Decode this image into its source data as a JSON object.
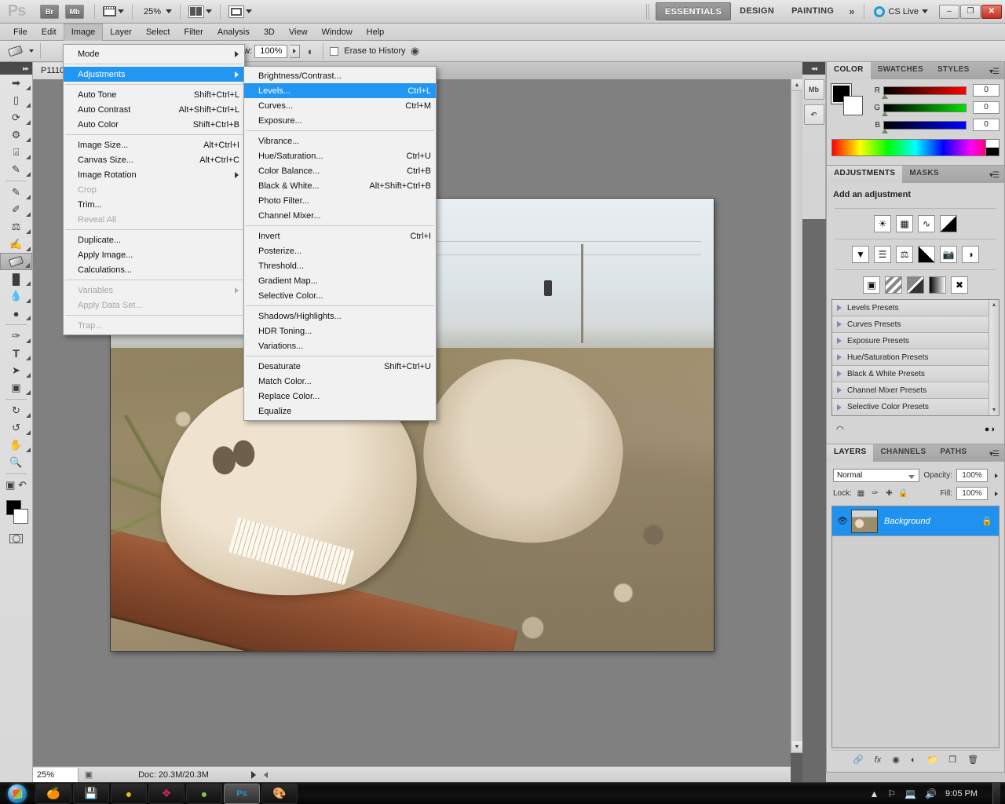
{
  "app": {
    "logo": "Ps",
    "bridge_label": "Br",
    "minibridge_label": "Mb",
    "zoom_level": "25%",
    "workspaces": [
      {
        "label": "ESSENTIALS",
        "active": true
      },
      {
        "label": "DESIGN",
        "active": false
      },
      {
        "label": "PAINTING",
        "active": false
      }
    ],
    "more_workspaces": "»",
    "cs_live": "CS Live",
    "window_buttons": {
      "minimize": "–",
      "restore": "❐",
      "close": "✕"
    }
  },
  "menubar": {
    "items": [
      {
        "label": "File",
        "open": false
      },
      {
        "label": "Edit",
        "open": false
      },
      {
        "label": "Image",
        "open": true
      },
      {
        "label": "Layer",
        "open": false
      },
      {
        "label": "Select",
        "open": false
      },
      {
        "label": "Filter",
        "open": false
      },
      {
        "label": "Analysis",
        "open": false
      },
      {
        "label": "3D",
        "open": false
      },
      {
        "label": "View",
        "open": false
      },
      {
        "label": "Window",
        "open": false
      },
      {
        "label": "Help",
        "open": false
      }
    ]
  },
  "options_bar": {
    "flow_label": "Flow:",
    "flow_value": "100%",
    "erase_to_history_label": "Erase to History",
    "erase_to_history_checked": false
  },
  "image_menu": {
    "items": [
      {
        "label": "Mode",
        "shortcut": "",
        "submenu": true,
        "disabled": false,
        "highlight": false
      },
      {
        "separator": true
      },
      {
        "label": "Adjustments",
        "shortcut": "",
        "submenu": true,
        "disabled": false,
        "highlight": true
      },
      {
        "separator": true
      },
      {
        "label": "Auto Tone",
        "shortcut": "Shift+Ctrl+L",
        "submenu": false,
        "disabled": false,
        "highlight": false
      },
      {
        "label": "Auto Contrast",
        "shortcut": "Alt+Shift+Ctrl+L",
        "submenu": false,
        "disabled": false,
        "highlight": false
      },
      {
        "label": "Auto Color",
        "shortcut": "Shift+Ctrl+B",
        "submenu": false,
        "disabled": false,
        "highlight": false
      },
      {
        "separator": true
      },
      {
        "label": "Image Size...",
        "shortcut": "Alt+Ctrl+I",
        "submenu": false,
        "disabled": false,
        "highlight": false
      },
      {
        "label": "Canvas Size...",
        "shortcut": "Alt+Ctrl+C",
        "submenu": false,
        "disabled": false,
        "highlight": false
      },
      {
        "label": "Image Rotation",
        "shortcut": "",
        "submenu": true,
        "disabled": false,
        "highlight": false
      },
      {
        "label": "Crop",
        "shortcut": "",
        "submenu": false,
        "disabled": true,
        "highlight": false
      },
      {
        "label": "Trim...",
        "shortcut": "",
        "submenu": false,
        "disabled": false,
        "highlight": false
      },
      {
        "label": "Reveal All",
        "shortcut": "",
        "submenu": false,
        "disabled": true,
        "highlight": false
      },
      {
        "separator": true
      },
      {
        "label": "Duplicate...",
        "shortcut": "",
        "submenu": false,
        "disabled": false,
        "highlight": false
      },
      {
        "label": "Apply Image...",
        "shortcut": "",
        "submenu": false,
        "disabled": false,
        "highlight": false
      },
      {
        "label": "Calculations...",
        "shortcut": "",
        "submenu": false,
        "disabled": false,
        "highlight": false
      },
      {
        "separator": true
      },
      {
        "label": "Variables",
        "shortcut": "",
        "submenu": true,
        "disabled": true,
        "highlight": false
      },
      {
        "label": "Apply Data Set...",
        "shortcut": "",
        "submenu": false,
        "disabled": true,
        "highlight": false
      },
      {
        "separator": true
      },
      {
        "label": "Trap...",
        "shortcut": "",
        "submenu": false,
        "disabled": true,
        "highlight": false
      }
    ]
  },
  "adjustments_menu": {
    "items": [
      {
        "label": "Brightness/Contrast...",
        "shortcut": "",
        "disabled": false,
        "highlight": false
      },
      {
        "label": "Levels...",
        "shortcut": "Ctrl+L",
        "disabled": false,
        "highlight": true
      },
      {
        "label": "Curves...",
        "shortcut": "Ctrl+M",
        "disabled": false,
        "highlight": false
      },
      {
        "label": "Exposure...",
        "shortcut": "",
        "disabled": false,
        "highlight": false
      },
      {
        "separator": true
      },
      {
        "label": "Vibrance...",
        "shortcut": "",
        "disabled": false,
        "highlight": false
      },
      {
        "label": "Hue/Saturation...",
        "shortcut": "Ctrl+U",
        "disabled": false,
        "highlight": false
      },
      {
        "label": "Color Balance...",
        "shortcut": "Ctrl+B",
        "disabled": false,
        "highlight": false
      },
      {
        "label": "Black & White...",
        "shortcut": "Alt+Shift+Ctrl+B",
        "disabled": false,
        "highlight": false
      },
      {
        "label": "Photo Filter...",
        "shortcut": "",
        "disabled": false,
        "highlight": false
      },
      {
        "label": "Channel Mixer...",
        "shortcut": "",
        "disabled": false,
        "highlight": false
      },
      {
        "separator": true
      },
      {
        "label": "Invert",
        "shortcut": "Ctrl+I",
        "disabled": false,
        "highlight": false
      },
      {
        "label": "Posterize...",
        "shortcut": "",
        "disabled": false,
        "highlight": false
      },
      {
        "label": "Threshold...",
        "shortcut": "",
        "disabled": false,
        "highlight": false
      },
      {
        "label": "Gradient Map...",
        "shortcut": "",
        "disabled": false,
        "highlight": false
      },
      {
        "label": "Selective Color...",
        "shortcut": "",
        "disabled": false,
        "highlight": false
      },
      {
        "separator": true
      },
      {
        "label": "Shadows/Highlights...",
        "shortcut": "",
        "disabled": false,
        "highlight": false
      },
      {
        "label": "HDR Toning...",
        "shortcut": "",
        "disabled": false,
        "highlight": false
      },
      {
        "label": "Variations...",
        "shortcut": "",
        "disabled": false,
        "highlight": false
      },
      {
        "separator": true
      },
      {
        "label": "Desaturate",
        "shortcut": "Shift+Ctrl+U",
        "disabled": false,
        "highlight": false
      },
      {
        "label": "Match Color...",
        "shortcut": "",
        "disabled": false,
        "highlight": false
      },
      {
        "label": "Replace Color...",
        "shortcut": "",
        "disabled": false,
        "highlight": false
      },
      {
        "label": "Equalize",
        "shortcut": "",
        "disabled": false,
        "highlight": false
      }
    ]
  },
  "toolbox": {
    "tools": [
      {
        "name": "move-tool",
        "glyph": "⤡",
        "selected": false
      },
      {
        "name": "marquee-tool",
        "glyph": "▢",
        "selected": false
      },
      {
        "name": "lasso-tool",
        "glyph": "⟲",
        "selected": false
      },
      {
        "name": "quick-selection-tool",
        "glyph": "❦",
        "selected": false
      },
      {
        "name": "crop-tool",
        "glyph": "⌧",
        "selected": false
      },
      {
        "name": "eyedropper-tool",
        "glyph": "✒",
        "selected": false
      },
      {
        "name": "spot-healing-brush-tool",
        "glyph": "✎",
        "selected": false
      },
      {
        "name": "brush-tool",
        "glyph": "✐",
        "selected": false
      },
      {
        "name": "clone-stamp-tool",
        "glyph": "⚑",
        "selected": false
      },
      {
        "name": "history-brush-tool",
        "glyph": "✍",
        "selected": false
      },
      {
        "name": "eraser-tool",
        "glyph": "▱",
        "selected": true
      },
      {
        "name": "gradient-tool",
        "glyph": "◨",
        "selected": false
      },
      {
        "name": "blur-tool",
        "glyph": "●",
        "selected": false
      },
      {
        "name": "dodge-tool",
        "glyph": "⚲",
        "selected": false
      },
      {
        "name": "pen-tool",
        "glyph": "✑",
        "selected": false
      },
      {
        "name": "type-tool",
        "glyph": "T",
        "selected": false
      },
      {
        "name": "path-selection-tool",
        "glyph": "➤",
        "selected": false
      },
      {
        "name": "shape-tool",
        "glyph": "■",
        "selected": false
      },
      {
        "name": "3d-rotate-tool",
        "glyph": "↻",
        "selected": false
      },
      {
        "name": "3d-orbit-tool",
        "glyph": "↺",
        "selected": false
      },
      {
        "name": "hand-tool",
        "glyph": "✋",
        "selected": false
      },
      {
        "name": "zoom-tool",
        "glyph": "⚲",
        "selected": false
      }
    ],
    "foreground_color": "#000000",
    "background_color": "#ffffff"
  },
  "document": {
    "tab_title": "P1110",
    "zoom_value": "25%",
    "doc_info": "Doc: 20.3M/20.3M"
  },
  "color_panel": {
    "tabs": [
      {
        "label": "COLOR",
        "active": true
      },
      {
        "label": "SWATCHES",
        "active": false
      },
      {
        "label": "STYLES",
        "active": false
      }
    ],
    "channels": [
      {
        "label": "R",
        "value": "0"
      },
      {
        "label": "G",
        "value": "0"
      },
      {
        "label": "B",
        "value": "0"
      }
    ]
  },
  "adjustments_panel": {
    "tabs": [
      {
        "label": "ADJUSTMENTS",
        "active": true
      },
      {
        "label": "MASKS",
        "active": false
      }
    ],
    "heading": "Add an adjustment",
    "icons_row1": [
      "brightness-contrast-icon",
      "levels-icon",
      "curves-icon",
      "exposure-icon"
    ],
    "icons_row2": [
      "vibrance-icon",
      "hue-saturation-icon",
      "color-balance-icon",
      "black-white-icon",
      "photo-filter-icon",
      "channel-mixer-icon"
    ],
    "icons_row3": [
      "invert-icon",
      "posterize-icon",
      "threshold-icon",
      "gradient-map-icon",
      "selective-color-icon"
    ],
    "presets": [
      "Levels Presets",
      "Curves Presets",
      "Exposure Presets",
      "Hue/Saturation Presets",
      "Black & White Presets",
      "Channel Mixer Presets",
      "Selective Color Presets"
    ]
  },
  "layers_panel": {
    "tabs": [
      {
        "label": "LAYERS",
        "active": true
      },
      {
        "label": "CHANNELS",
        "active": false
      },
      {
        "label": "PATHS",
        "active": false
      }
    ],
    "blend_mode": "Normal",
    "opacity_label": "Opacity:",
    "opacity_value": "100%",
    "lock_label": "Lock:",
    "fill_label": "Fill:",
    "fill_value": "100%",
    "layers": [
      {
        "name": "Background",
        "selected": true,
        "locked": true,
        "visible": true
      }
    ]
  },
  "taskbar": {
    "items": [
      {
        "name": "firefox",
        "glyph": "🦊",
        "active": false
      },
      {
        "name": "save-app",
        "glyph": "💾",
        "active": false
      },
      {
        "name": "amber-app",
        "glyph": "🟠",
        "active": false
      },
      {
        "name": "corel-app",
        "glyph": "❖",
        "active": false
      },
      {
        "name": "green-app",
        "glyph": "🐸",
        "active": false
      },
      {
        "name": "photoshop",
        "glyph": "Ps",
        "active": true
      },
      {
        "name": "paint-app",
        "glyph": "🎨",
        "active": false
      }
    ],
    "clock": "9:05 PM"
  },
  "colors": {
    "highlight": "#2196f3",
    "layer_selected": "#1f92f0",
    "panel_bg": "#d4d4d4"
  }
}
